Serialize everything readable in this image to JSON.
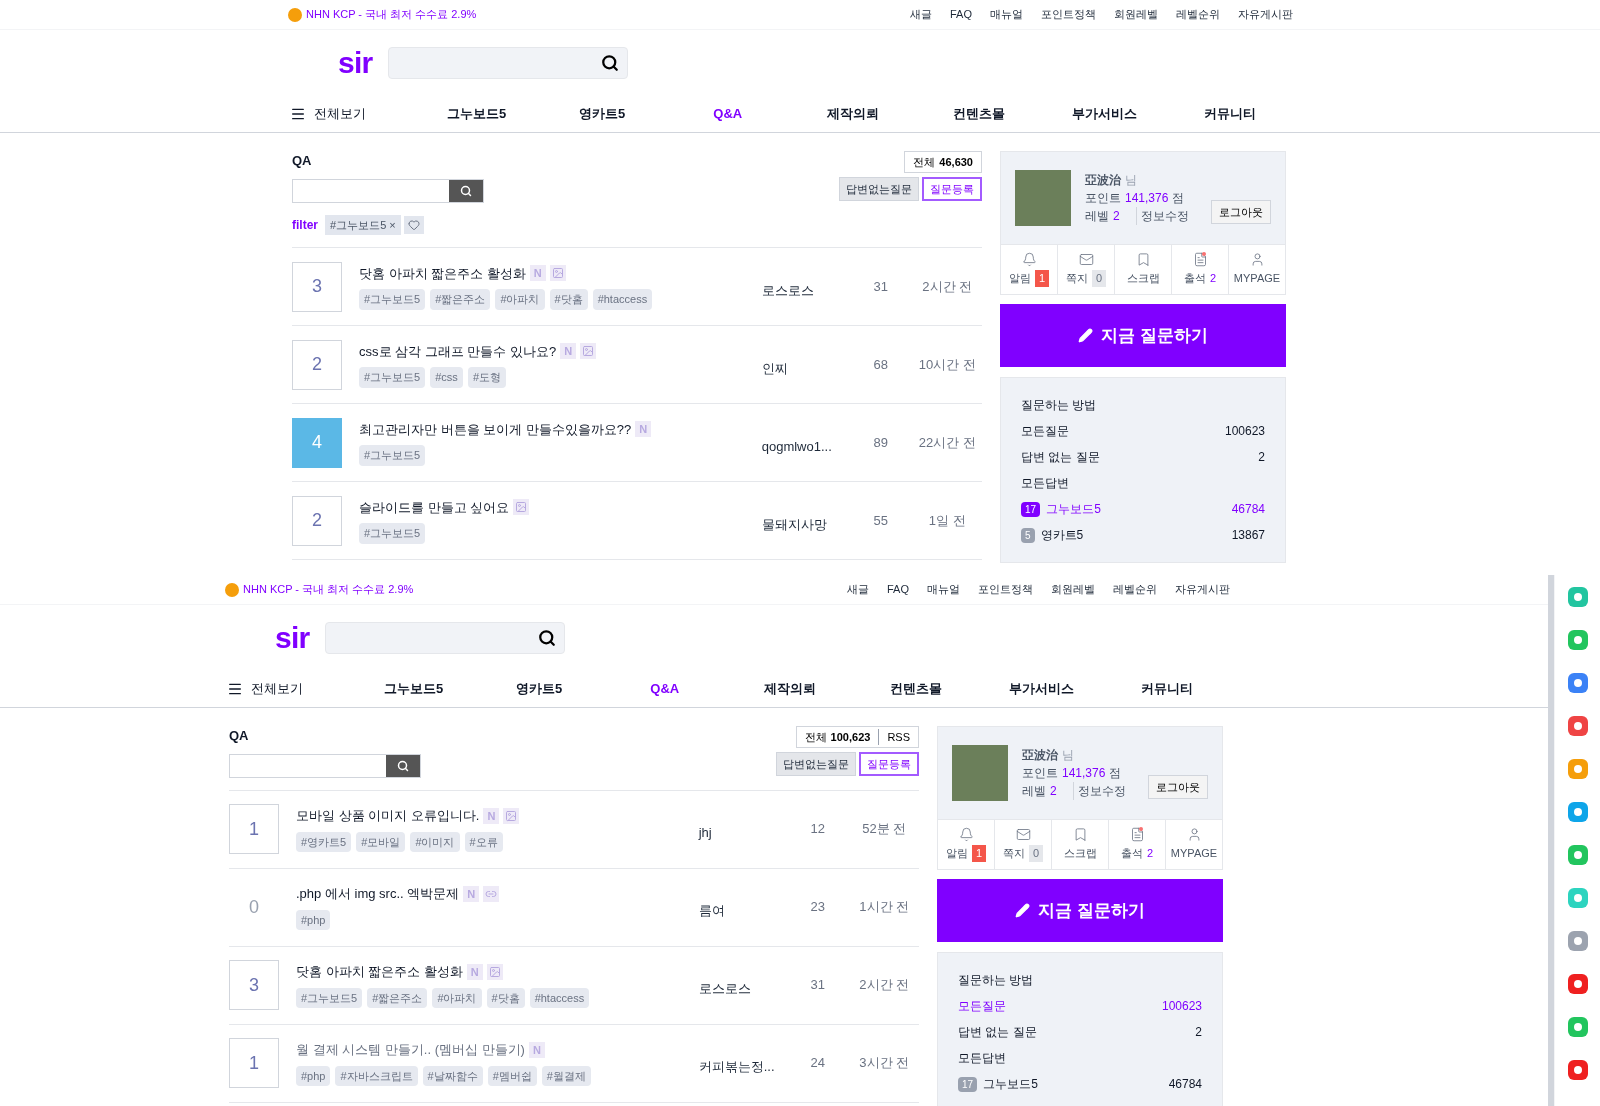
{
  "panels": [
    {
      "notice": "NHN KCP - 국내 최저 수수료 2.9%",
      "top_links": [
        "새글",
        "FAQ",
        "매뉴얼",
        "포인트정책",
        "회원레벨",
        "레벨순위",
        "자유게시판"
      ],
      "logo": "sir",
      "nav": [
        {
          "label": "전체보기",
          "kind": "menu",
          "selected": false
        },
        {
          "label": "그누보드5",
          "kind": "link",
          "selected": false
        },
        {
          "label": "영카트5",
          "kind": "link",
          "selected": false
        },
        {
          "label": "Q&A",
          "kind": "link",
          "selected": true
        },
        {
          "label": "제작의뢰",
          "kind": "link",
          "selected": false
        },
        {
          "label": "컨텐츠몰",
          "kind": "link",
          "selected": false
        },
        {
          "label": "부가서비스",
          "kind": "link",
          "selected": false
        },
        {
          "label": "커뮤니티",
          "kind": "link",
          "selected": false
        }
      ],
      "board": {
        "title": "QA",
        "total_label": "전체",
        "total": "46,630",
        "buttons": [
          "답변없는질문",
          "질문등록"
        ],
        "filter": {
          "label": "filter",
          "tags": [
            {
              "text": "#그누보드5",
              "remove": "×"
            }
          ]
        },
        "posts": [
          {
            "answers": "3",
            "kind": "boxed",
            "title": "닷홈 아파치 짧은주소 활성화",
            "dimmed": false,
            "badges": [
              {
                "kind": "new",
                "text": "N"
              },
              {
                "kind": "image"
              }
            ],
            "tags": [
              "#그누보드5",
              "#짧은주소",
              "#아파치",
              "#닷홈",
              "#htaccess"
            ],
            "author": "로스로스",
            "views": "31",
            "time": "2시간 전"
          },
          {
            "answers": "2",
            "kind": "boxed",
            "title": "css로 삼각 그래프 만들수 있나요?",
            "dimmed": false,
            "badges": [
              {
                "kind": "new",
                "text": "N"
              },
              {
                "kind": "image"
              }
            ],
            "tags": [
              "#그누보드5",
              "#css",
              "#도형"
            ],
            "author": "인찌",
            "views": "68",
            "time": "10시간 전"
          },
          {
            "answers": "4",
            "kind": "adopted",
            "title": "최고관리자만 버튼을 보이게 만들수있을까요??",
            "dimmed": false,
            "badges": [
              {
                "kind": "new",
                "text": "N"
              }
            ],
            "tags": [
              "#그누보드5"
            ],
            "author": "qogmlwo1...",
            "views": "89",
            "time": "22시간 전"
          },
          {
            "answers": "2",
            "kind": "boxed",
            "title": "슬라이드를 만들고 싶어요",
            "dimmed": false,
            "badges": [
              {
                "kind": "image"
              }
            ],
            "tags": [
              "#그누보드5"
            ],
            "author": "물돼지사망",
            "views": "55",
            "time": "1일 전"
          }
        ]
      },
      "sidebar": {
        "name": "亞波治",
        "honorific": "님",
        "points_label": "포인트",
        "points": "141,376",
        "points_unit": "점",
        "level_label": "레벨",
        "level": "2",
        "edit": "정보수정",
        "logout": "로그아웃",
        "tiles": [
          {
            "label": "알림",
            "count": "1",
            "kind": "alert",
            "notify": false
          },
          {
            "label": "쪽지",
            "count": "0",
            "kind": "plain",
            "notify": false
          },
          {
            "label": "스크랩",
            "notify": false
          },
          {
            "label": "출석",
            "count": "2",
            "kind": "accent",
            "notify": true
          },
          {
            "label": "MYPAGE",
            "notify": false
          }
        ],
        "ask": "지금 질문하기",
        "stats": [
          {
            "label": "질문하는 방법",
            "selected": false
          },
          {
            "label": "모든질문",
            "value": "100623",
            "selected": false
          },
          {
            "label": "답변 없는 질문",
            "value": "2",
            "selected": false
          },
          {
            "label": "모든답변",
            "selected": false
          },
          {
            "badge": "17",
            "label": "그누보드5",
            "value": "46784",
            "selected": true
          },
          {
            "badge": "5",
            "label": "영카트5",
            "value": "13867",
            "selected": false
          }
        ]
      }
    },
    {
      "notice": "NHN KCP - 국내 최저 수수료 2.9%",
      "top_links": [
        "새글",
        "FAQ",
        "매뉴얼",
        "포인트정책",
        "회원레벨",
        "레벨순위",
        "자유게시판"
      ],
      "logo": "sir",
      "nav": [
        {
          "label": "전체보기",
          "kind": "menu",
          "selected": false
        },
        {
          "label": "그누보드5",
          "kind": "link",
          "selected": false
        },
        {
          "label": "영카트5",
          "kind": "link",
          "selected": false
        },
        {
          "label": "Q&A",
          "kind": "link",
          "selected": true
        },
        {
          "label": "제작의뢰",
          "kind": "link",
          "selected": false
        },
        {
          "label": "컨텐츠몰",
          "kind": "link",
          "selected": false
        },
        {
          "label": "부가서비스",
          "kind": "link",
          "selected": false
        },
        {
          "label": "커뮤니티",
          "kind": "link",
          "selected": false
        }
      ],
      "board": {
        "title": "QA",
        "total_label": "전체",
        "total": "100,623",
        "rss": "RSS",
        "buttons": [
          "답변없는질문",
          "질문등록"
        ],
        "posts": [
          {
            "answers": "1",
            "kind": "boxed",
            "title": "모바일 상품 이미지 오류입니다.",
            "dimmed": false,
            "badges": [
              {
                "kind": "new",
                "text": "N"
              },
              {
                "kind": "image"
              }
            ],
            "tags": [
              "#영카트5",
              "#모바일",
              "#이미지",
              "#오류"
            ],
            "author": "jhj",
            "views": "12",
            "time": "52분 전"
          },
          {
            "answers": "0",
            "kind": "plain",
            "title": ".php 에서 img src.. 엑박문제",
            "dimmed": false,
            "badges": [
              {
                "kind": "new",
                "text": "N"
              },
              {
                "kind": "link"
              }
            ],
            "tags": [
              "#php"
            ],
            "author": "름여",
            "views": "23",
            "time": "1시간 전"
          },
          {
            "answers": "3",
            "kind": "boxed",
            "title": "닷홈 아파치 짧은주소 활성화",
            "dimmed": false,
            "badges": [
              {
                "kind": "new",
                "text": "N"
              },
              {
                "kind": "image"
              }
            ],
            "tags": [
              "#그누보드5",
              "#짧은주소",
              "#아파치",
              "#닷홈",
              "#htaccess"
            ],
            "author": "로스로스",
            "views": "31",
            "time": "2시간 전"
          },
          {
            "answers": "1",
            "kind": "boxed",
            "title": "월 결제 시스템 만들기.. (멤버십 만들기)",
            "dimmed": true,
            "badges": [
              {
                "kind": "new",
                "text": "N"
              }
            ],
            "tags": [
              "#php",
              "#자바스크립트",
              "#날짜함수",
              "#멤버쉽",
              "#월결제"
            ],
            "author": "커피볶는정...",
            "views": "24",
            "time": "3시간 전"
          }
        ]
      },
      "sidebar": {
        "name": "亞波治",
        "honorific": "님",
        "points_label": "포인트",
        "points": "141,376",
        "points_unit": "점",
        "level_label": "레벨",
        "level": "2",
        "edit": "정보수정",
        "logout": "로그아웃",
        "tiles": [
          {
            "label": "알림",
            "count": "1",
            "kind": "alert",
            "notify": false
          },
          {
            "label": "쪽지",
            "count": "0",
            "kind": "plain",
            "notify": false
          },
          {
            "label": "스크랩",
            "notify": false
          },
          {
            "label": "출석",
            "count": "2",
            "kind": "accent",
            "notify": true
          },
          {
            "label": "MYPAGE",
            "notify": false
          }
        ],
        "ask": "지금 질문하기",
        "stats": [
          {
            "label": "질문하는 방법",
            "selected": false
          },
          {
            "label": "모든질문",
            "value": "100623",
            "selected": true
          },
          {
            "label": "답변 없는 질문",
            "value": "2",
            "selected": false
          },
          {
            "label": "모든답변",
            "selected": false
          },
          {
            "badge": "17",
            "label": "그누보드5",
            "value": "46784",
            "selected": false
          }
        ]
      }
    }
  ]
}
